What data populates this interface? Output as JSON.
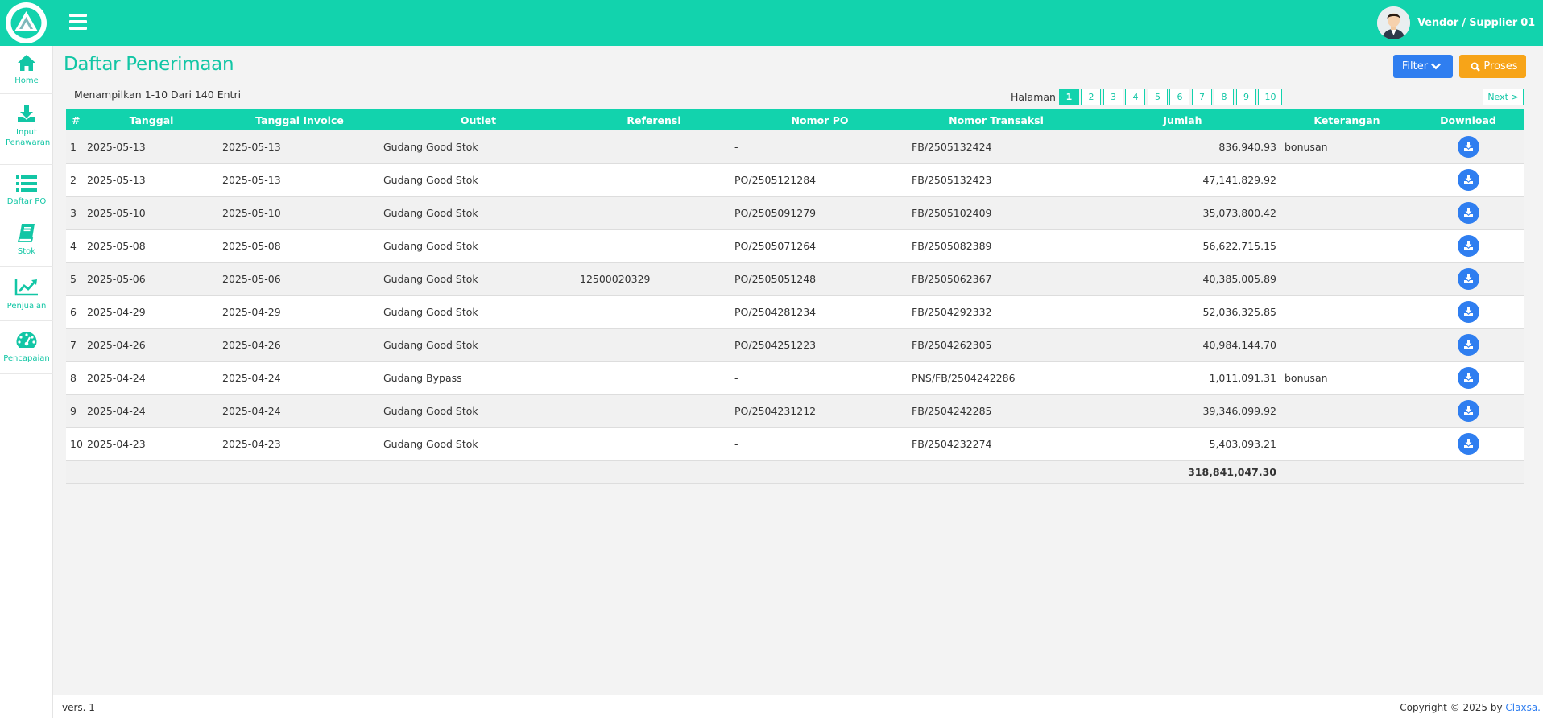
{
  "header": {
    "user_name": "Vendor / Supplier 01"
  },
  "sidebar": {
    "items": [
      {
        "label": "Home",
        "icon": "home-icon"
      },
      {
        "label": "Input Penawaran",
        "icon": "download-tray-icon"
      },
      {
        "label": "Daftar PO",
        "icon": "list-icon"
      },
      {
        "label": "Stok",
        "icon": "book-icon"
      },
      {
        "label": "Penjualan",
        "icon": "line-chart-icon"
      },
      {
        "label": "Pencapaian",
        "icon": "dashboard-gauge-icon"
      }
    ]
  },
  "page": {
    "title": "Daftar Penerimaan",
    "filter_label": "Filter",
    "proses_label": "Proses",
    "info": "Menampilkan 1-10 Dari 140 Entri",
    "pager_label": "Halaman",
    "pages": [
      "1",
      "2",
      "3",
      "4",
      "5",
      "6",
      "7",
      "8",
      "9",
      "10"
    ],
    "active_page": "1",
    "next_label": "Next >"
  },
  "table": {
    "columns": [
      "#",
      "Tanggal",
      "Tanggal Invoice",
      "Outlet",
      "Referensi",
      "Nomor PO",
      "Nomor Transaksi",
      "Jumlah",
      "Keterangan",
      "Download"
    ],
    "rows": [
      {
        "no": "1",
        "tanggal": "2025-05-13",
        "invoice": "2025-05-13",
        "outlet": "Gudang Good Stok",
        "ref": "",
        "po": "-",
        "trx": "FB/2505132424",
        "jumlah": "836,940.93",
        "ket": "bonusan"
      },
      {
        "no": "2",
        "tanggal": "2025-05-13",
        "invoice": "2025-05-13",
        "outlet": "Gudang Good Stok",
        "ref": "",
        "po": "PO/2505121284",
        "trx": "FB/2505132423",
        "jumlah": "47,141,829.92",
        "ket": ""
      },
      {
        "no": "3",
        "tanggal": "2025-05-10",
        "invoice": "2025-05-10",
        "outlet": "Gudang Good Stok",
        "ref": "",
        "po": "PO/2505091279",
        "trx": "FB/2505102409",
        "jumlah": "35,073,800.42",
        "ket": ""
      },
      {
        "no": "4",
        "tanggal": "2025-05-08",
        "invoice": "2025-05-08",
        "outlet": "Gudang Good Stok",
        "ref": "",
        "po": "PO/2505071264",
        "trx": "FB/2505082389",
        "jumlah": "56,622,715.15",
        "ket": ""
      },
      {
        "no": "5",
        "tanggal": "2025-05-06",
        "invoice": "2025-05-06",
        "outlet": "Gudang Good Stok",
        "ref": "12500020329",
        "po": "PO/2505051248",
        "trx": "FB/2505062367",
        "jumlah": "40,385,005.89",
        "ket": ""
      },
      {
        "no": "6",
        "tanggal": "2025-04-29",
        "invoice": "2025-04-29",
        "outlet": "Gudang Good Stok",
        "ref": "",
        "po": "PO/2504281234",
        "trx": "FB/2504292332",
        "jumlah": "52,036,325.85",
        "ket": ""
      },
      {
        "no": "7",
        "tanggal": "2025-04-26",
        "invoice": "2025-04-26",
        "outlet": "Gudang Good Stok",
        "ref": "",
        "po": "PO/2504251223",
        "trx": "FB/2504262305",
        "jumlah": "40,984,144.70",
        "ket": ""
      },
      {
        "no": "8",
        "tanggal": "2025-04-24",
        "invoice": "2025-04-24",
        "outlet": "Gudang Bypass",
        "ref": "",
        "po": "-",
        "trx": "PNS/FB/2504242286",
        "jumlah": "1,011,091.31",
        "ket": "bonusan"
      },
      {
        "no": "9",
        "tanggal": "2025-04-24",
        "invoice": "2025-04-24",
        "outlet": "Gudang Good Stok",
        "ref": "",
        "po": "PO/2504231212",
        "trx": "FB/2504242285",
        "jumlah": "39,346,099.92",
        "ket": ""
      },
      {
        "no": "10",
        "tanggal": "2025-04-23",
        "invoice": "2025-04-23",
        "outlet": "Gudang Good Stok",
        "ref": "",
        "po": "-",
        "trx": "FB/2504232274",
        "jumlah": "5,403,093.21",
        "ket": ""
      }
    ],
    "total": "318,841,047.30"
  },
  "footer": {
    "version": "vers. 1",
    "copyright": "Copyright © 2025 by ",
    "company": "Claxsa."
  },
  "colors": {
    "primary": "#12d3ad",
    "blue": "#2f7ef0",
    "orange": "#f7a418"
  }
}
